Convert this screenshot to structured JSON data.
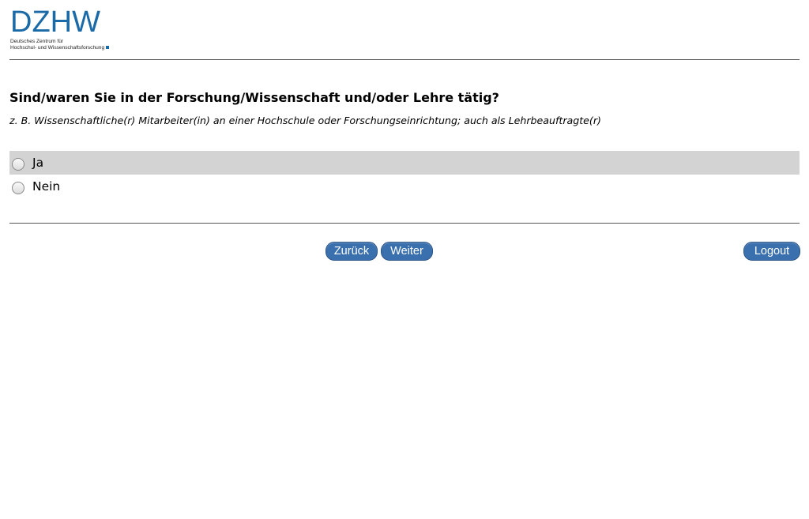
{
  "logo": {
    "mark": "DZHW",
    "line1": "Deutsches Zentrum für",
    "line2": "Hochschul- und Wissenschaftsforschung"
  },
  "question": {
    "text": "Sind/waren Sie in der Forschung/Wissenschaft und/oder Lehre tätig?",
    "hint": "z. B. Wissenschaftliche(r) Mitarbeiter(in) an einer Hochschule oder Forschungseinrichtung; auch als Lehrbeauftragte(r)"
  },
  "options": [
    {
      "label": "Ja",
      "hovered": true
    },
    {
      "label": "Nein",
      "hovered": false
    }
  ],
  "buttons": {
    "back": "Zurück",
    "next": "Weiter",
    "logout": "Logout"
  },
  "colors": {
    "brand": "#1a6aa8",
    "button": "#3a70ad",
    "hover_row": "#d3d3d3"
  }
}
